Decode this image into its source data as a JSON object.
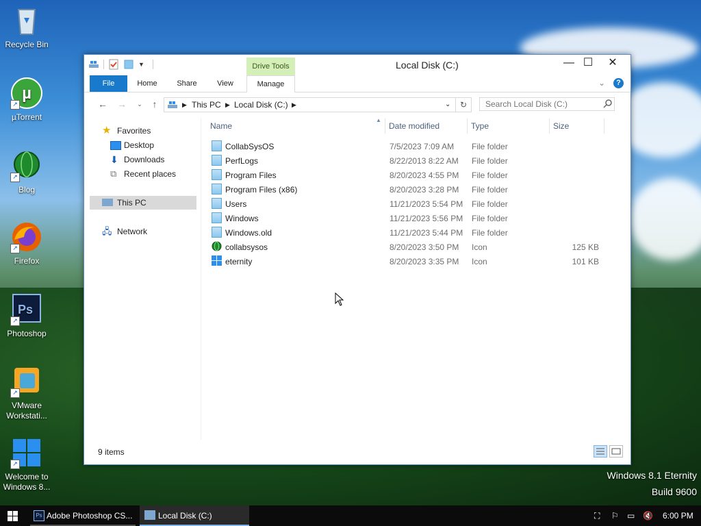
{
  "desktop": {
    "icons": [
      {
        "label": "Recycle Bin"
      },
      {
        "label": "µTorrent"
      },
      {
        "label": "Blog"
      },
      {
        "label": "Firefox"
      },
      {
        "label": "Photoshop"
      },
      {
        "label": "VMware Workstati..."
      },
      {
        "label": "Welcome to Windows 8..."
      }
    ],
    "watermark_line1": "Windows 8.1 Eternity",
    "watermark_line2": "Build 9600"
  },
  "window": {
    "title": "Local Disk (C:)",
    "drive_tools_label": "Drive Tools",
    "tabs": [
      "File",
      "Home",
      "Share",
      "View",
      "Manage"
    ],
    "address": {
      "part1": "This PC",
      "part2": "Local Disk (C:)"
    },
    "search_placeholder": "Search Local Disk (C:)",
    "nav": {
      "favorites": "Favorites",
      "desktop": "Desktop",
      "downloads": "Downloads",
      "recent": "Recent places",
      "this_pc": "This PC",
      "network": "Network"
    },
    "columns": {
      "name": "Name",
      "date": "Date modified",
      "type": "Type",
      "size": "Size"
    },
    "files": [
      {
        "name": "CollabSysOS",
        "date": "7/5/2023 7:09 AM",
        "type": "File folder",
        "size": "",
        "icon": "folder-icon"
      },
      {
        "name": "PerfLogs",
        "date": "8/22/2013 8:22 AM",
        "type": "File folder",
        "size": "",
        "icon": "folder-icon"
      },
      {
        "name": "Program Files",
        "date": "8/20/2023 4:55 PM",
        "type": "File folder",
        "size": "",
        "icon": "folder-icon"
      },
      {
        "name": "Program Files (x86)",
        "date": "8/20/2023 3:28 PM",
        "type": "File folder",
        "size": "",
        "icon": "folder-icon"
      },
      {
        "name": "Users",
        "date": "11/21/2023 5:54 PM",
        "type": "File folder",
        "size": "",
        "icon": "folder-icon"
      },
      {
        "name": "Windows",
        "date": "11/21/2023 5:56 PM",
        "type": "File folder",
        "size": "",
        "icon": "folder-icon"
      },
      {
        "name": "Windows.old",
        "date": "11/21/2023 5:44 PM",
        "type": "File folder",
        "size": "",
        "icon": "folder-icon"
      },
      {
        "name": "collabsysos",
        "date": "8/20/2023 3:50 PM",
        "type": "Icon",
        "size": "125 KB",
        "icon": "globe-icon"
      },
      {
        "name": "eternity",
        "date": "8/20/2023 3:35 PM",
        "type": "Icon",
        "size": "101 KB",
        "icon": "windows-logo-icon"
      }
    ],
    "status": "9 items"
  },
  "taskbar": {
    "items": [
      "Adobe Photoshop CS...",
      "Local Disk (C:)"
    ],
    "clock": "6:00 PM"
  },
  "colors": {
    "accent": "#1979ca",
    "drive_tools_bg": "#d5efb8",
    "taskbar_bg": "#0b0b0b"
  }
}
